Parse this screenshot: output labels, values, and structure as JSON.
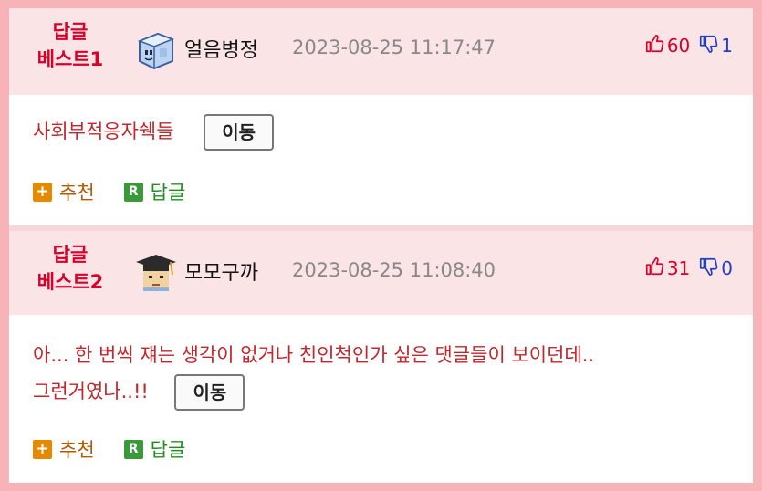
{
  "comments": [
    {
      "best_label_1": "답글",
      "best_label_2": "베스트1",
      "nickname": "얼음병정",
      "avatar": "ice-cube-avatar",
      "datetime": "2023-08-25 11:17:47",
      "upvotes": "60",
      "downvotes": "1",
      "text": "사회부적응자쉑들",
      "move_label": "이동",
      "recommend_label": "추천",
      "reply_label": "답글"
    },
    {
      "best_label_1": "답글",
      "best_label_2": "베스트2",
      "nickname": "모모구까",
      "avatar": "graduate-avatar",
      "datetime": "2023-08-25 11:08:40",
      "upvotes": "31",
      "downvotes": "0",
      "text_line1": "아... 한 번씩 쟤는 생각이 없거나 친인척인가 싶은 댓글들이 보이던데..",
      "text_line2": "그런거였나..!!",
      "move_label": "이동",
      "recommend_label": "추천",
      "reply_label": "답글"
    }
  ],
  "colors": {
    "border": "#f7b3b7",
    "header_bg": "#fbe4e6",
    "best_label": "#d6002a",
    "upvote": "#d6002a",
    "downvote": "#1f3fbf",
    "comment_text": "#c1272d"
  },
  "icons": {
    "upvote": "thumbs-up-icon",
    "downvote": "thumbs-down-icon",
    "recommend": "plus-square-icon",
    "reply": "r-square-icon"
  }
}
